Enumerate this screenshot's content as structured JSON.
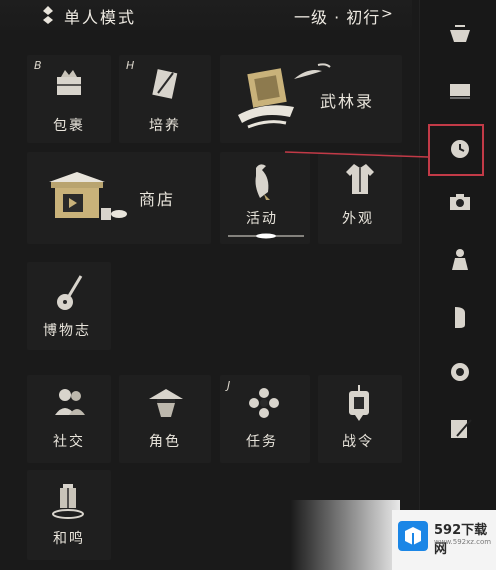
{
  "header": {
    "mode_label": "单人模式",
    "level_label": "一级 · 初行",
    "level_chevron": ">"
  },
  "tiles": {
    "bag": {
      "label": "包裹",
      "key": "B"
    },
    "cultivate": {
      "label": "培养",
      "key": "H"
    },
    "wulinlu": {
      "label": "武林录"
    },
    "shop": {
      "label": "商店"
    },
    "activity": {
      "label": "活动"
    },
    "appearance": {
      "label": "外观"
    },
    "museum": {
      "label": "博物志"
    },
    "social": {
      "label": "社交"
    },
    "character": {
      "label": "角色"
    },
    "quest": {
      "label": "任务",
      "key": "J"
    },
    "battlepass": {
      "label": "战令"
    },
    "heming": {
      "label": "和鸣"
    }
  },
  "watermark": {
    "title": "592下载网",
    "sub": "www.592xz.com"
  },
  "colors": {
    "background": "#1a1a1a",
    "tile": "#1f1f1f",
    "gold": "#c9b27a",
    "highlight_red": "#c23a47"
  },
  "rail_icons": [
    "cup-icon",
    "book-icon",
    "clock-icon",
    "camera-icon",
    "person-icon",
    "scroll-icon",
    "gear-icon",
    "edit-icon"
  ]
}
